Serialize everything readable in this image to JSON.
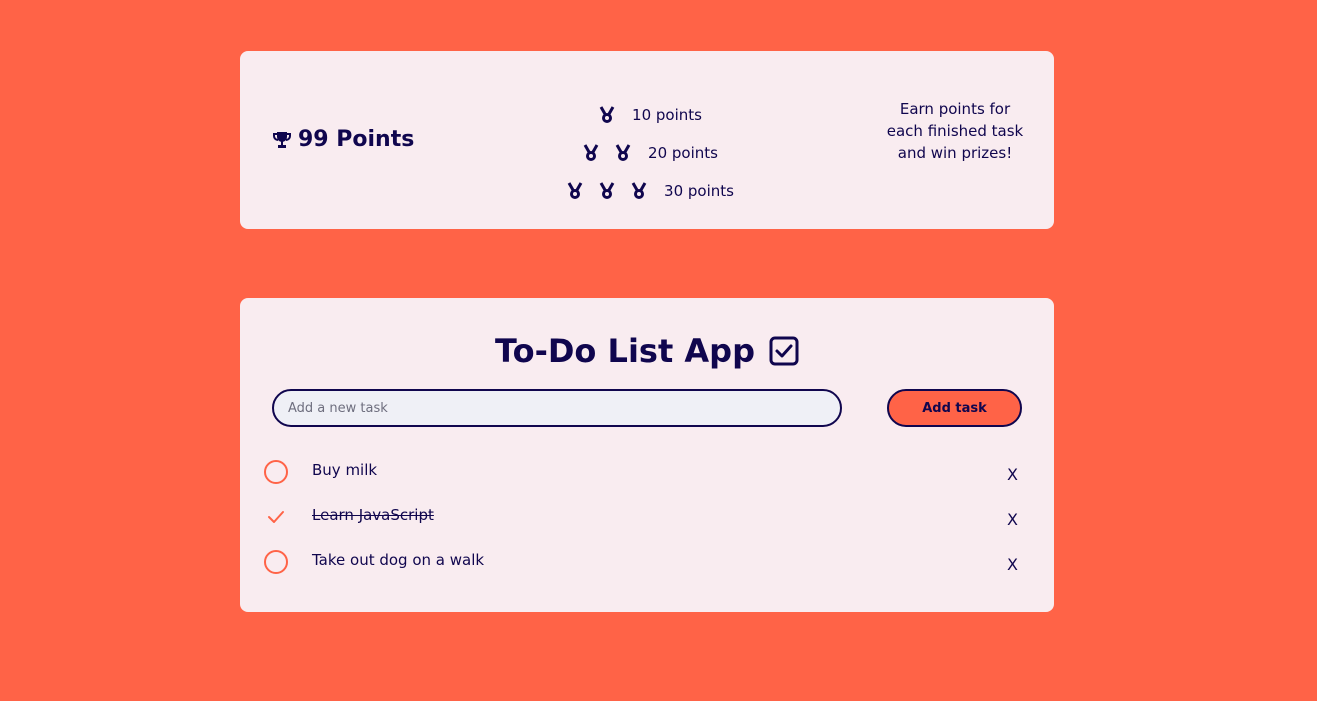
{
  "points_card": {
    "score_label": "99 Points",
    "icon": "trophy-icon",
    "tiers": [
      {
        "medals": 1,
        "label": "10 points"
      },
      {
        "medals": 2,
        "label": "20 points"
      },
      {
        "medals": 3,
        "label": "30 points"
      }
    ],
    "blurb": "Earn points for each finished task and win prizes!"
  },
  "todo": {
    "title": "To-Do List App",
    "title_icon": "checkbox-checked-icon",
    "input": {
      "value": "",
      "placeholder": "Add a new task"
    },
    "add_button_label": "Add task",
    "tasks": [
      {
        "text": "Buy milk",
        "done": false,
        "delete_label": "X"
      },
      {
        "text": "Learn JavaScript",
        "done": true,
        "delete_label": "X"
      },
      {
        "text": "Take out dog on a walk",
        "done": false,
        "delete_label": "X"
      }
    ]
  },
  "colors": {
    "background": "#ff6347",
    "card": "#f9ecf0",
    "text": "#10064e",
    "accent": "#ff6347"
  }
}
